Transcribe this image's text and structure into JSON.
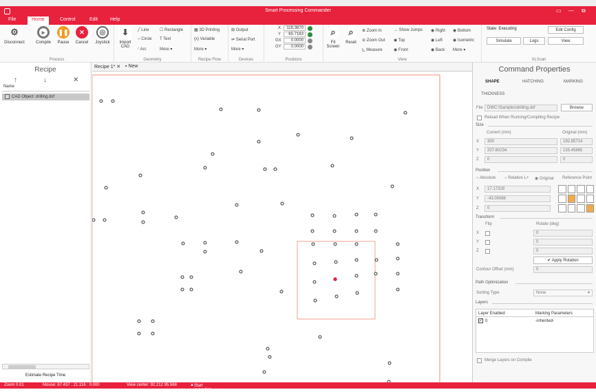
{
  "window": {
    "title": "Smart Processing Commander",
    "minimize": "—",
    "maximize": "▭",
    "close": "⧉"
  },
  "menu": {
    "items": [
      "File",
      "Home",
      "Control",
      "Edit",
      "Help"
    ],
    "active": "Home"
  },
  "ribbon": {
    "process": {
      "label": "Process",
      "buttons": [
        "Disconnect",
        "Compile",
        "Pause",
        "Cancel",
        "Joystick"
      ]
    },
    "geometry": {
      "label": "Geometry",
      "import": "Import CAD",
      "line": "Line",
      "rectangle": "Rectangle",
      "circle": "Circle",
      "text": "Text",
      "arc": "Arc",
      "more": "More"
    },
    "recipe_flow": {
      "label": "Recipe Flow",
      "printing": "3D Printing",
      "variable": "Variable",
      "more": "More"
    },
    "devices": {
      "label": "Devices",
      "output": "Output",
      "serial": "Serial Port",
      "more": "More"
    },
    "positions": {
      "label": "Positions",
      "x_label": "X",
      "x": "118.3870",
      "y_label": "Y",
      "y": "65.7163",
      "gx_label": "GX",
      "gx": "0.0000",
      "gy_label": "GY",
      "gy": "0.0000"
    },
    "view": {
      "label": "View",
      "fit": "Fit Screen",
      "reset": "Reset",
      "zoom_in": "Zoom In",
      "zoom_out": "Zoom Out",
      "measure": "Measure",
      "show_jumps": "Show Jumps",
      "top": "Top",
      "front": "Front",
      "right": "Right",
      "left": "Left",
      "back": "Back",
      "bottom": "Bottom",
      "isometric": "Isometric",
      "more": "More"
    },
    "xlscan": {
      "label": "XLScan",
      "state": "State: Executing",
      "edit_config": "Edit Config",
      "simulate": "Simulate",
      "logs": "Logs",
      "view": "View"
    }
  },
  "recipe": {
    "title": "Recipe",
    "col_name": "Name",
    "item": "CAD Object: drilling.dxf",
    "estimate": "Estimate Recipe Time"
  },
  "tabs": {
    "recipe_tab": "Recipe 1*",
    "new_tab": "New"
  },
  "props": {
    "title": "Command Properties",
    "tabs": [
      "SHAPE",
      "HATCHING",
      "MARKING",
      "THICKNESS"
    ],
    "file_label": "File",
    "file": "DWC:\\Samples\\drilling.dxf",
    "browse": "Browse",
    "reload": "Reload When Running/Compiling Recipe",
    "size": "Size",
    "current": "Current (mm)",
    "original": "Original (mm)",
    "sx": "300",
    "sy": "207.60234",
    "sz": "0",
    "ox": "192.85714",
    "oy": "133.45865",
    "oz": "0",
    "position": "Position",
    "absolute": "Absolute",
    "relative": "Relative L+",
    "orig": "Original",
    "ref_point": "Reference Point",
    "px": "17.17328",
    "py": "-43.00066",
    "pz": "0",
    "transform": "Transform",
    "flip": "Flip",
    "rotate": "Rotate (deg)",
    "r1": "0",
    "r2": "0",
    "r3": "0",
    "apply": "Apply Rotation",
    "contour": "Contour Offset (mm)",
    "contour_val": "0",
    "path_opt": "Path Optimization",
    "sorting": "Sorting Type",
    "sorting_val": "None",
    "layers": "Layers",
    "layer_enabled": "Layer Enabled",
    "marking_params": "Marking Parameters",
    "layer0": "0",
    "inherited": "-inherited-",
    "merge": "Merge Layers on Compile",
    "axis_x": "X",
    "axis_y": "Y",
    "axis_z": "Z"
  },
  "status": {
    "zoom": "Zoom 0.01",
    "mouse": "Mouse: 87.437 : 21.116 : 0.000",
    "view_center": "View center: 92.212 95.568",
    "msg": "Start execution."
  },
  "colors": {
    "accent": "#e8213d",
    "selection": "#f0a090",
    "point_active": "#e8213d"
  }
}
